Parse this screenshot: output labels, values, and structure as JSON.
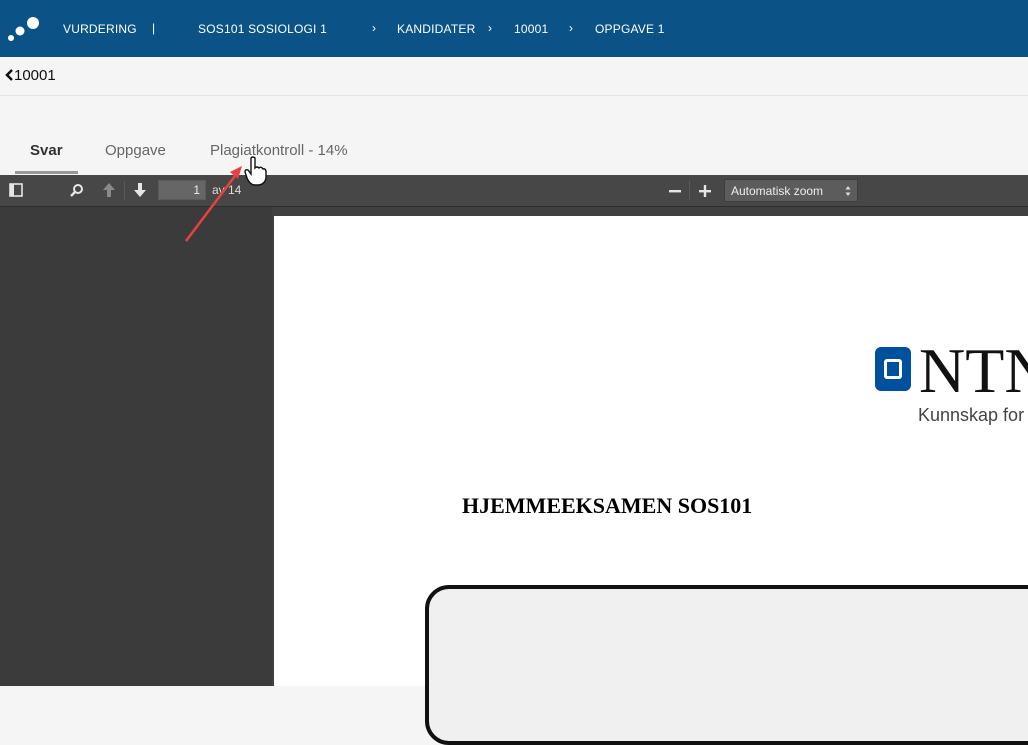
{
  "topbar": {
    "items": [
      "VURDERING",
      "SOS101 SOSIOLOGI 1",
      "KANDIDATER",
      "10001",
      "OPPGAVE 1"
    ],
    "separators": [
      "|",
      "›",
      "›",
      "›"
    ]
  },
  "back": {
    "label": "10001"
  },
  "tabs": [
    {
      "label": "Svar",
      "active": true
    },
    {
      "label": "Oppgave",
      "active": false
    },
    {
      "label": "Plagiatkontroll - 14%",
      "active": false
    }
  ],
  "pdf_toolbar": {
    "page_value": "1",
    "page_count": "av 14",
    "zoom_label": "Automatisk zoom",
    "icons": [
      "sidebar-toggle-icon",
      "search-icon",
      "previous-page-icon",
      "next-page-icon",
      "zoom-out-icon",
      "zoom-in-icon"
    ]
  },
  "document": {
    "logo_text": "NTN",
    "logo_tagline": "Kunnskap for en",
    "title": "HJEMMEEKSAMEN SOS101"
  },
  "colors": {
    "topbar": "#0b5387",
    "pdf_toolbar": "#474747",
    "ntnu_blue": "#00509e",
    "annotation_arrow": "#e8413f"
  }
}
